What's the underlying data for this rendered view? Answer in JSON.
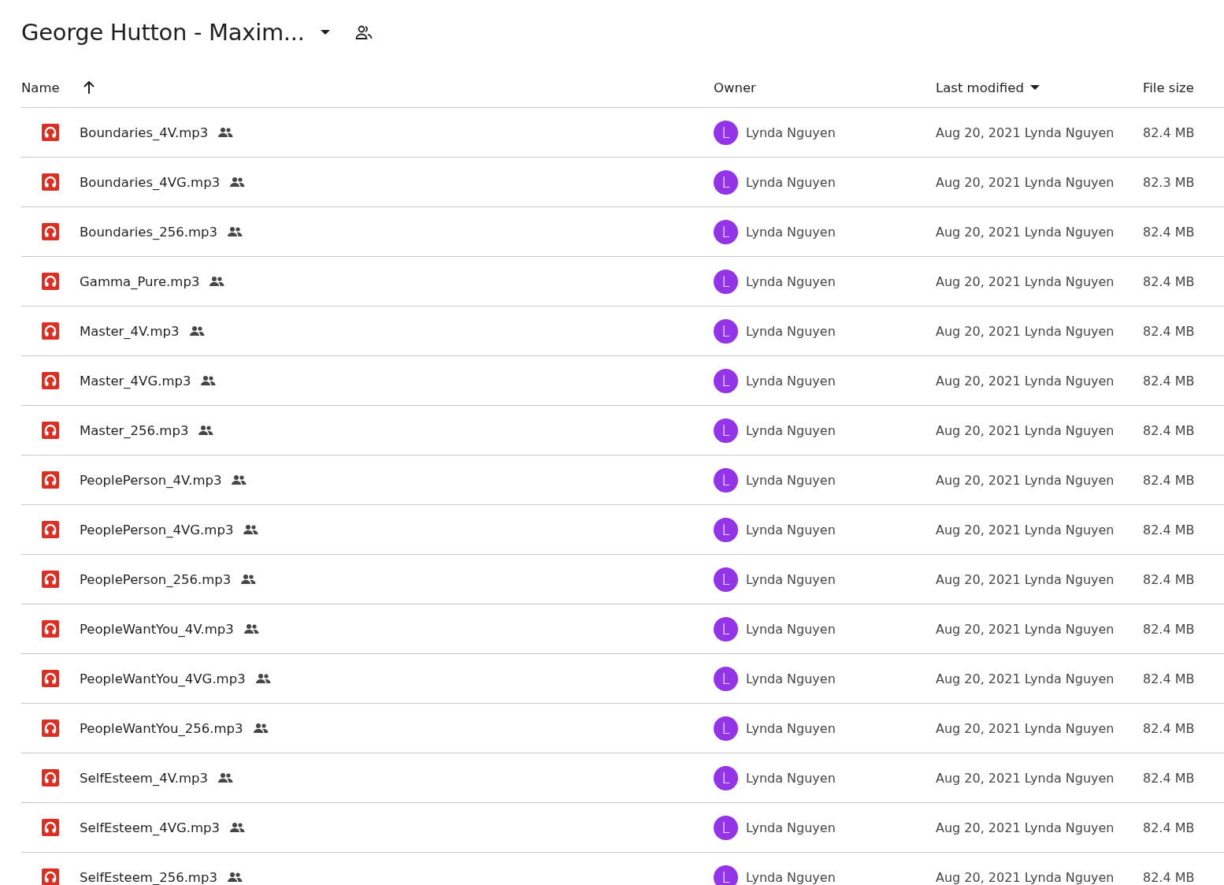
{
  "folder": {
    "title": "George Hutton - Maxim..."
  },
  "columns": [
    {
      "label": "Name",
      "kind": "sort-arrow"
    },
    {
      "label": "Owner",
      "kind": "plain"
    },
    {
      "label": "Last modified",
      "kind": "caret"
    },
    {
      "label": "File size",
      "kind": "plain"
    }
  ],
  "rows": [
    {
      "name": "Boundaries_4V.mp3",
      "shared": true,
      "owner_initial": "L",
      "owner": "Lynda Nguyen",
      "modified": "Aug 20, 2021 Lynda Nguyen",
      "size": "82.4 MB"
    },
    {
      "name": "Boundaries_4VG.mp3",
      "shared": true,
      "owner_initial": "L",
      "owner": "Lynda Nguyen",
      "modified": "Aug 20, 2021 Lynda Nguyen",
      "size": "82.3 MB"
    },
    {
      "name": "Boundaries_256.mp3",
      "shared": true,
      "owner_initial": "L",
      "owner": "Lynda Nguyen",
      "modified": "Aug 20, 2021 Lynda Nguyen",
      "size": "82.4 MB"
    },
    {
      "name": "Gamma_Pure.mp3",
      "shared": true,
      "owner_initial": "L",
      "owner": "Lynda Nguyen",
      "modified": "Aug 20, 2021 Lynda Nguyen",
      "size": "82.4 MB"
    },
    {
      "name": "Master_4V.mp3",
      "shared": true,
      "owner_initial": "L",
      "owner": "Lynda Nguyen",
      "modified": "Aug 20, 2021 Lynda Nguyen",
      "size": "82.4 MB"
    },
    {
      "name": "Master_4VG.mp3",
      "shared": true,
      "owner_initial": "L",
      "owner": "Lynda Nguyen",
      "modified": "Aug 20, 2021 Lynda Nguyen",
      "size": "82.4 MB"
    },
    {
      "name": "Master_256.mp3",
      "shared": true,
      "owner_initial": "L",
      "owner": "Lynda Nguyen",
      "modified": "Aug 20, 2021 Lynda Nguyen",
      "size": "82.4 MB"
    },
    {
      "name": "PeoplePerson_4V.mp3",
      "shared": true,
      "owner_initial": "L",
      "owner": "Lynda Nguyen",
      "modified": "Aug 20, 2021 Lynda Nguyen",
      "size": "82.4 MB"
    },
    {
      "name": "PeoplePerson_4VG.mp3",
      "shared": true,
      "owner_initial": "L",
      "owner": "Lynda Nguyen",
      "modified": "Aug 20, 2021 Lynda Nguyen",
      "size": "82.4 MB"
    },
    {
      "name": "PeoplePerson_256.mp3",
      "shared": true,
      "owner_initial": "L",
      "owner": "Lynda Nguyen",
      "modified": "Aug 20, 2021 Lynda Nguyen",
      "size": "82.4 MB"
    },
    {
      "name": "PeopleWantYou_4V.mp3",
      "shared": true,
      "owner_initial": "L",
      "owner": "Lynda Nguyen",
      "modified": "Aug 20, 2021 Lynda Nguyen",
      "size": "82.4 MB"
    },
    {
      "name": "PeopleWantYou_4VG.mp3",
      "shared": true,
      "owner_initial": "L",
      "owner": "Lynda Nguyen",
      "modified": "Aug 20, 2021 Lynda Nguyen",
      "size": "82.4 MB"
    },
    {
      "name": "PeopleWantYou_256.mp3",
      "shared": true,
      "owner_initial": "L",
      "owner": "Lynda Nguyen",
      "modified": "Aug 20, 2021 Lynda Nguyen",
      "size": "82.4 MB"
    },
    {
      "name": "SelfEsteem_4V.mp3",
      "shared": true,
      "owner_initial": "L",
      "owner": "Lynda Nguyen",
      "modified": "Aug 20, 2021 Lynda Nguyen",
      "size": "82.4 MB"
    },
    {
      "name": "SelfEsteem_4VG.mp3",
      "shared": true,
      "owner_initial": "L",
      "owner": "Lynda Nguyen",
      "modified": "Aug 20, 2021 Lynda Nguyen",
      "size": "82.4 MB"
    },
    {
      "name": "SelfEsteem_256.mp3",
      "shared": true,
      "owner_initial": "L",
      "owner": "Lynda Nguyen",
      "modified": "Aug 20, 2021 Lynda Nguyen",
      "size": "82.4 MB"
    }
  ]
}
